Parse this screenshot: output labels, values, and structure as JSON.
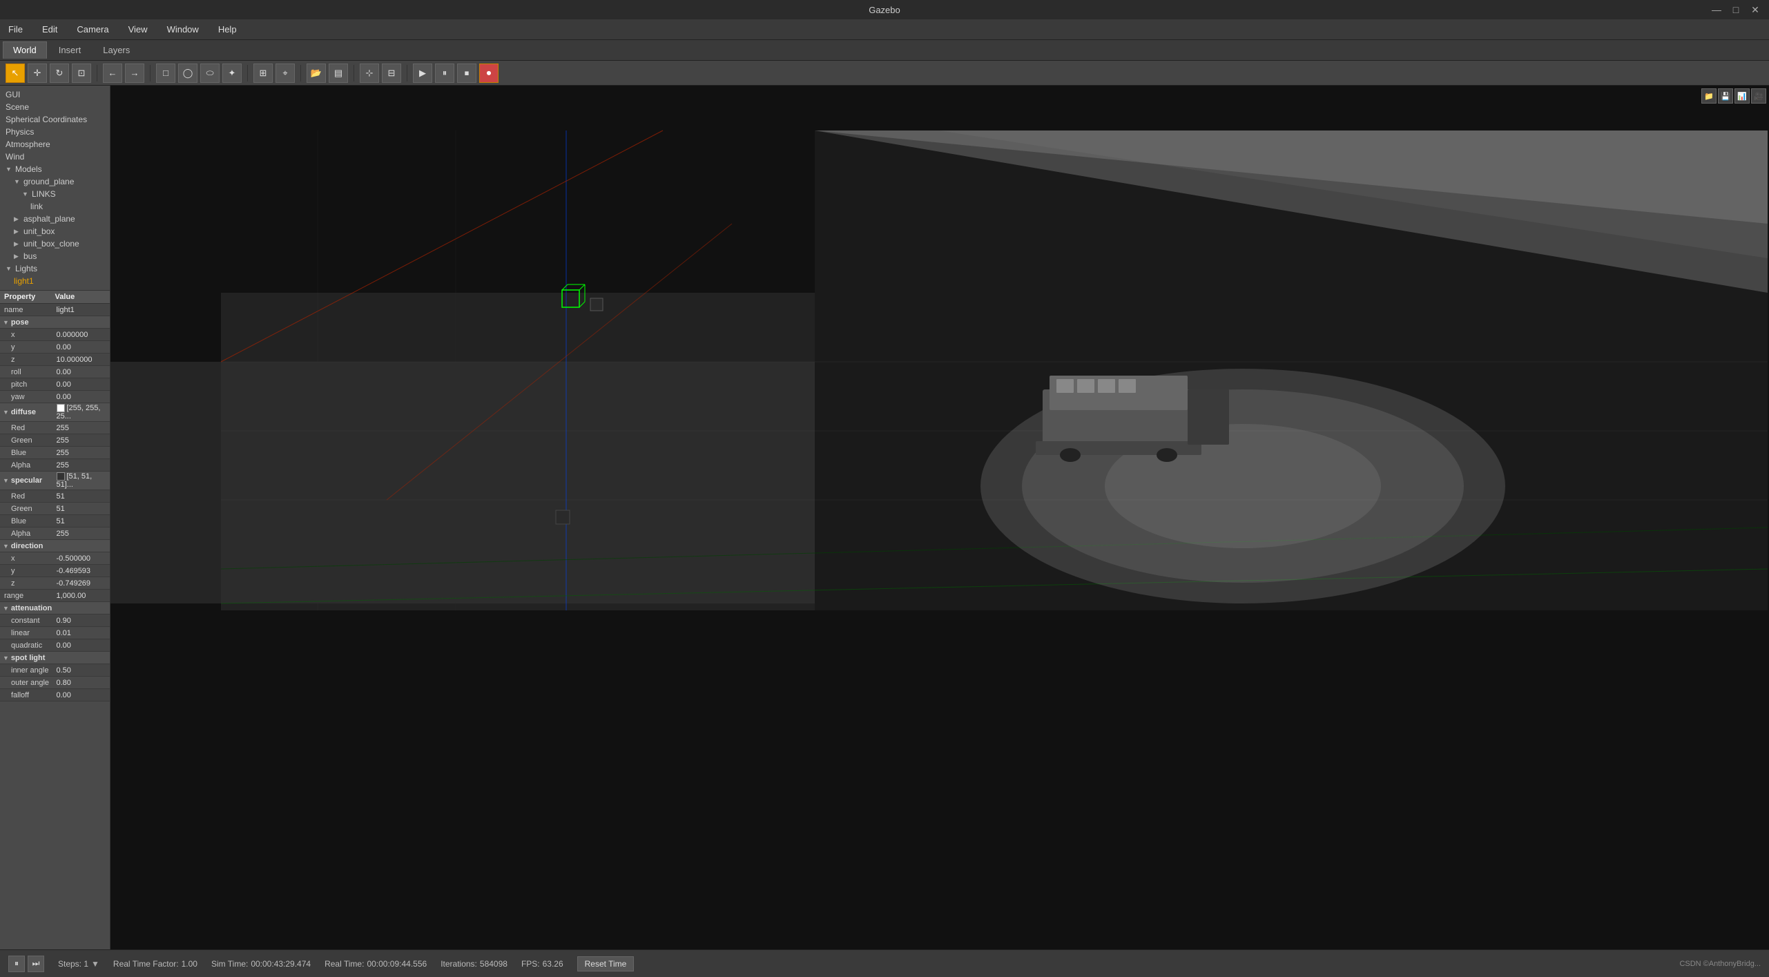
{
  "app": {
    "title": "Gazebo",
    "win_minimize": "—",
    "win_restore": "□",
    "win_close": "✕"
  },
  "menubar": {
    "items": [
      "File",
      "Edit",
      "Camera",
      "View",
      "Window",
      "Help"
    ]
  },
  "tabs": {
    "items": [
      "World",
      "Insert",
      "Layers"
    ],
    "active": "World"
  },
  "toolbar": {
    "buttons": [
      {
        "name": "select",
        "icon": "↖",
        "active": true
      },
      {
        "name": "translate",
        "icon": "✛",
        "active": false
      },
      {
        "name": "rotate",
        "icon": "↻",
        "active": false
      },
      {
        "name": "scale",
        "icon": "⊡",
        "active": false
      },
      {
        "name": "undo",
        "icon": "←",
        "active": false
      },
      {
        "name": "redo",
        "icon": "→",
        "active": false
      },
      {
        "name": "box",
        "icon": "□",
        "active": false
      },
      {
        "name": "sphere",
        "icon": "◯",
        "active": false
      },
      {
        "name": "cylinder",
        "icon": "⬭",
        "active": false
      },
      {
        "name": "light",
        "icon": "✦",
        "active": false
      },
      {
        "name": "grid",
        "icon": "⊞",
        "active": false
      },
      {
        "name": "measure",
        "icon": "⌖",
        "active": false
      },
      {
        "name": "save",
        "icon": "▤",
        "active": false
      },
      {
        "name": "snap",
        "icon": "⊹",
        "active": false
      },
      {
        "name": "record",
        "icon": "⏺",
        "active": true
      }
    ]
  },
  "world_tree": {
    "items": [
      {
        "label": "GUI",
        "indent": 0,
        "has_arrow": false,
        "selected": false
      },
      {
        "label": "Scene",
        "indent": 0,
        "has_arrow": false,
        "selected": false
      },
      {
        "label": "Spherical Coordinates",
        "indent": 0,
        "has_arrow": false,
        "selected": false
      },
      {
        "label": "Physics",
        "indent": 0,
        "has_arrow": false,
        "selected": false
      },
      {
        "label": "Atmosphere",
        "indent": 0,
        "has_arrow": false,
        "selected": false
      },
      {
        "label": "Wind",
        "indent": 0,
        "has_arrow": false,
        "selected": false
      },
      {
        "label": "Models",
        "indent": 0,
        "has_arrow": true,
        "expanded": true,
        "selected": false
      },
      {
        "label": "ground_plane",
        "indent": 1,
        "has_arrow": true,
        "expanded": true,
        "selected": false
      },
      {
        "label": "LINKS",
        "indent": 2,
        "has_arrow": true,
        "expanded": true,
        "selected": false
      },
      {
        "label": "link",
        "indent": 3,
        "has_arrow": false,
        "selected": false
      },
      {
        "label": "asphalt_plane",
        "indent": 1,
        "has_arrow": true,
        "expanded": false,
        "selected": false
      },
      {
        "label": "unit_box",
        "indent": 1,
        "has_arrow": true,
        "expanded": false,
        "selected": false
      },
      {
        "label": "unit_box_clone",
        "indent": 1,
        "has_arrow": true,
        "expanded": false,
        "selected": false
      },
      {
        "label": "bus",
        "indent": 1,
        "has_arrow": true,
        "expanded": false,
        "selected": false
      },
      {
        "label": "Lights",
        "indent": 0,
        "has_arrow": true,
        "expanded": true,
        "selected": false
      },
      {
        "label": "light1",
        "indent": 1,
        "has_arrow": false,
        "selected": true
      }
    ]
  },
  "properties": {
    "header": {
      "property": "Property",
      "value": "Value"
    },
    "rows": [
      {
        "name": "name",
        "indent": "normal",
        "value": "light1",
        "type": "text",
        "group": false
      },
      {
        "name": "▼ pose",
        "indent": "group",
        "value": "",
        "type": "group",
        "group": true
      },
      {
        "name": "x",
        "indent": "sub",
        "value": "0.000000",
        "type": "text"
      },
      {
        "name": "y",
        "indent": "sub",
        "value": "0.00",
        "type": "text"
      },
      {
        "name": "z",
        "indent": "sub",
        "value": "10.000000",
        "type": "text"
      },
      {
        "name": "roll",
        "indent": "sub",
        "value": "0.00",
        "type": "text"
      },
      {
        "name": "pitch",
        "indent": "sub",
        "value": "0.00",
        "type": "text"
      },
      {
        "name": "yaw",
        "indent": "sub",
        "value": "0.00",
        "type": "text"
      },
      {
        "name": "▼ diffuse",
        "indent": "group",
        "value": "[255, 255, 25...",
        "type": "color",
        "group": true,
        "color": "#ffffff"
      },
      {
        "name": "Red",
        "indent": "sub",
        "value": "255",
        "type": "text"
      },
      {
        "name": "Green",
        "indent": "sub",
        "value": "255",
        "type": "text"
      },
      {
        "name": "Blue",
        "indent": "sub",
        "value": "255",
        "type": "text"
      },
      {
        "name": "Alpha",
        "indent": "sub",
        "value": "255",
        "type": "text"
      },
      {
        "name": "▼ specular",
        "indent": "group",
        "value": "[51, 51, 51]...",
        "type": "color",
        "group": true,
        "color": "#333333"
      },
      {
        "name": "Red",
        "indent": "sub",
        "value": "51",
        "type": "text"
      },
      {
        "name": "Green",
        "indent": "sub",
        "value": "51",
        "type": "text"
      },
      {
        "name": "Blue",
        "indent": "sub",
        "value": "51",
        "type": "text"
      },
      {
        "name": "Alpha",
        "indent": "sub",
        "value": "255",
        "type": "text"
      },
      {
        "name": "▼ direction",
        "indent": "group",
        "value": "",
        "type": "group",
        "group": true
      },
      {
        "name": "x",
        "indent": "sub",
        "value": "-0.500000",
        "type": "text"
      },
      {
        "name": "y",
        "indent": "sub",
        "value": "-0.469593",
        "type": "text"
      },
      {
        "name": "z",
        "indent": "sub",
        "value": "-0.749269",
        "type": "text"
      },
      {
        "name": "range",
        "indent": "normal",
        "value": "1,000.00",
        "type": "text"
      },
      {
        "name": "▼ attenuation",
        "indent": "group",
        "value": "",
        "type": "group",
        "group": true
      },
      {
        "name": "constant",
        "indent": "sub",
        "value": "0.90",
        "type": "text"
      },
      {
        "name": "linear",
        "indent": "sub",
        "value": "0.01",
        "type": "text"
      },
      {
        "name": "quadratic",
        "indent": "sub",
        "value": "0.00",
        "type": "text"
      },
      {
        "name": "▼ spot light",
        "indent": "group",
        "value": "",
        "type": "group",
        "group": true
      },
      {
        "name": "inner angle",
        "indent": "sub",
        "value": "0.50",
        "type": "text"
      },
      {
        "name": "outer angle",
        "indent": "sub",
        "value": "0.80",
        "type": "text"
      },
      {
        "name": "falloff",
        "indent": "sub",
        "value": "0.00",
        "type": "text"
      }
    ]
  },
  "statusbar": {
    "play_btn": "▶",
    "pause_btn": "⏸",
    "step_btn": "⏭",
    "steps_label": "Steps: 1",
    "step_arrow": "▼",
    "real_time_factor_label": "Real Time Factor:",
    "real_time_factor": "1.00",
    "sim_time_label": "Sim Time:",
    "sim_time": "00:00:43:29.474",
    "real_time_label": "Real Time:",
    "real_time": "00:00:09:44.556",
    "iterations_label": "Iterations:",
    "iterations": "584098",
    "fps_label": "FPS:",
    "fps": "63.26",
    "reset_btn": "Reset Time",
    "credits": "CSDN ©AnthonyBridg..."
  },
  "viewport_btns": [
    "📁",
    "💾",
    "📊",
    "🎥"
  ]
}
